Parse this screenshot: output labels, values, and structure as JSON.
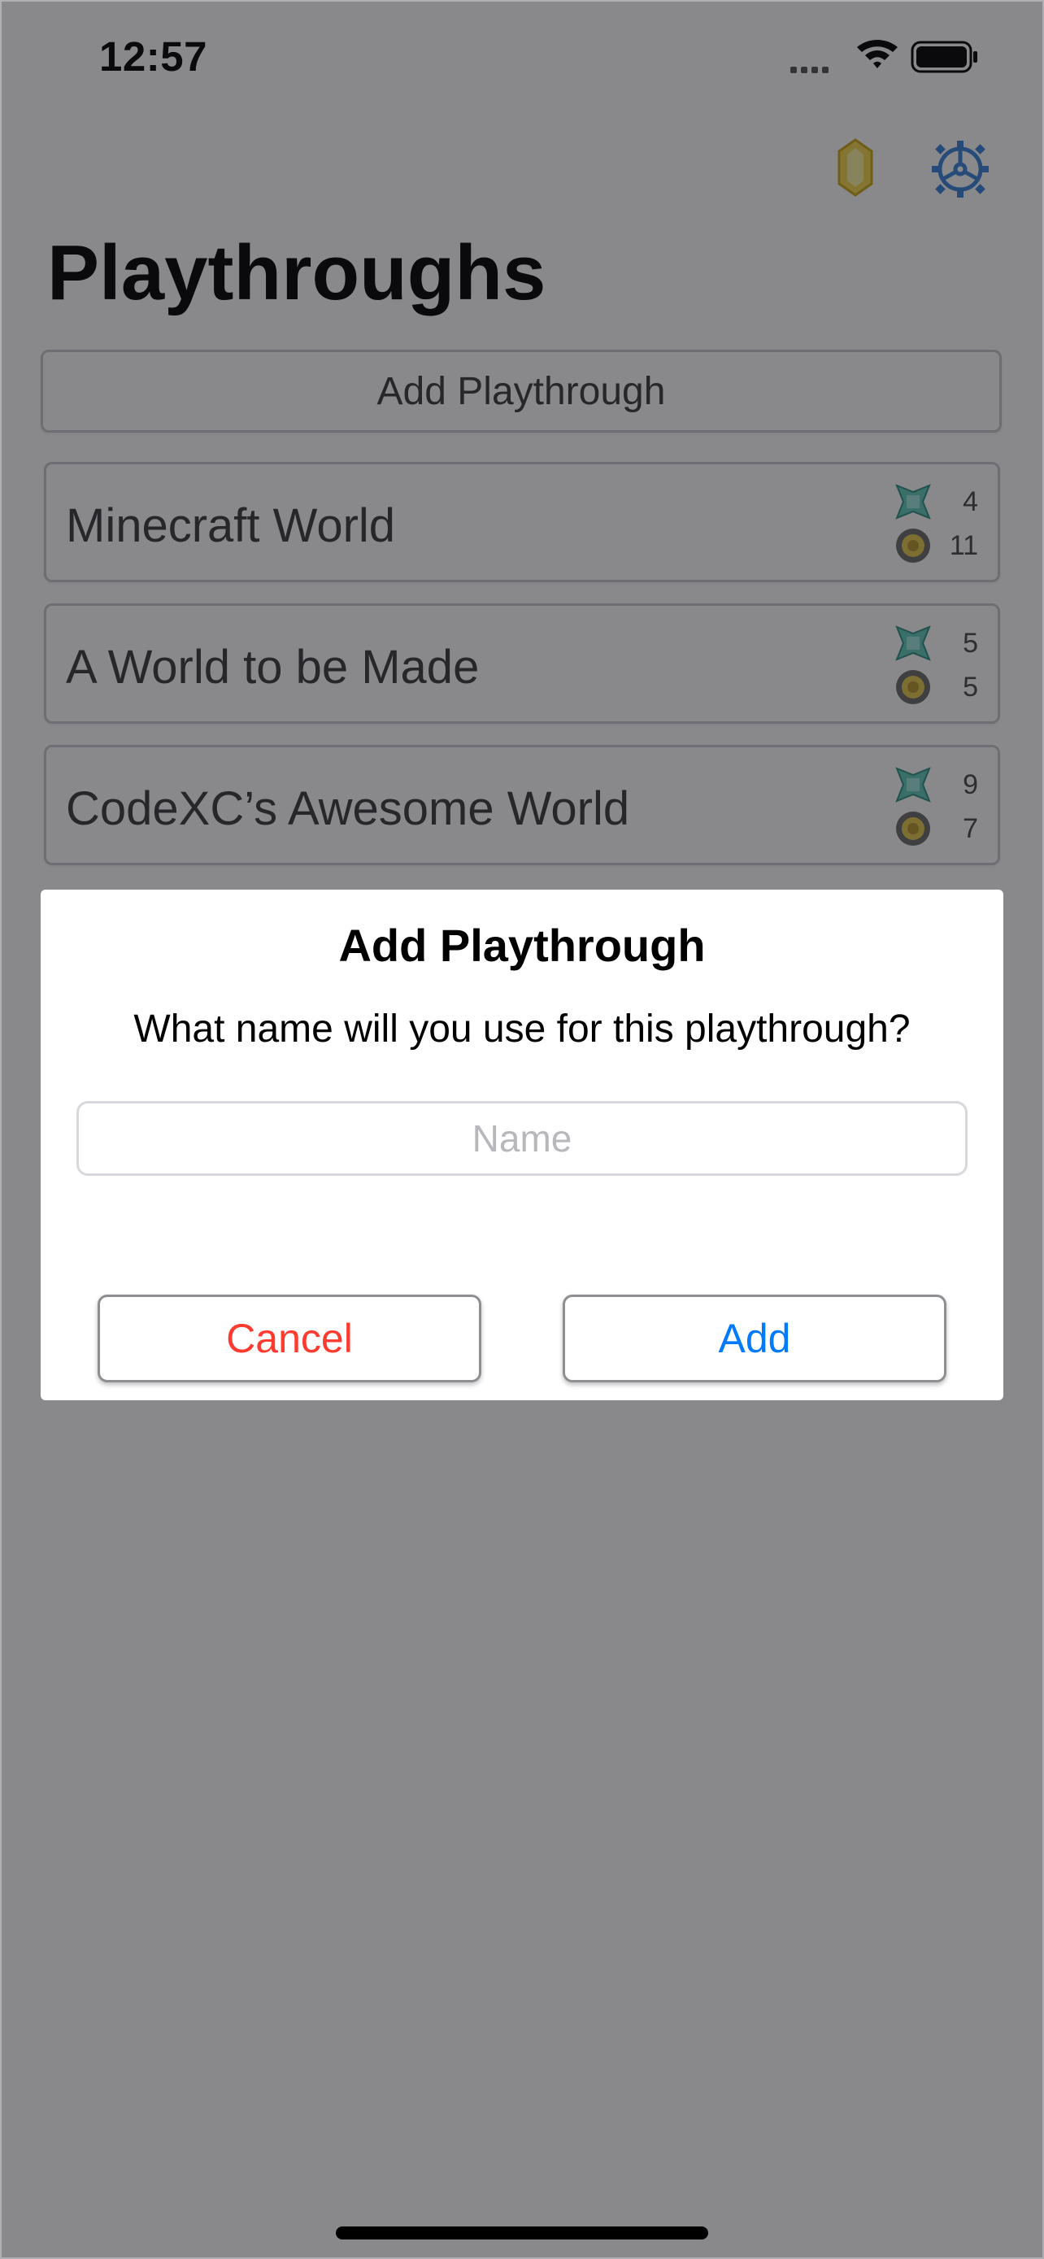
{
  "status_bar": {
    "time": "12:57"
  },
  "toolbar": {
    "rupee_icon": "rupee-icon",
    "settings_icon": "gear-icon",
    "accent_color": "#3b82d6"
  },
  "page": {
    "title": "Playthroughs",
    "add_button_label": "Add Playthrough"
  },
  "playthroughs": [
    {
      "name": "Minecraft World",
      "stat_top": "4",
      "stat_bottom": "11"
    },
    {
      "name": "A World to be Made",
      "stat_top": "5",
      "stat_bottom": "5"
    },
    {
      "name": "CodeXC’s Awesome World",
      "stat_top": "9",
      "stat_bottom": "7"
    }
  ],
  "dialog": {
    "title": "Add Playthrough",
    "message": "What name will you use for this playthrough?",
    "input_placeholder": "Name",
    "input_value": "",
    "cancel_label": "Cancel",
    "add_label": "Add",
    "cancel_color": "#ff3b30",
    "add_color": "#007aff"
  }
}
